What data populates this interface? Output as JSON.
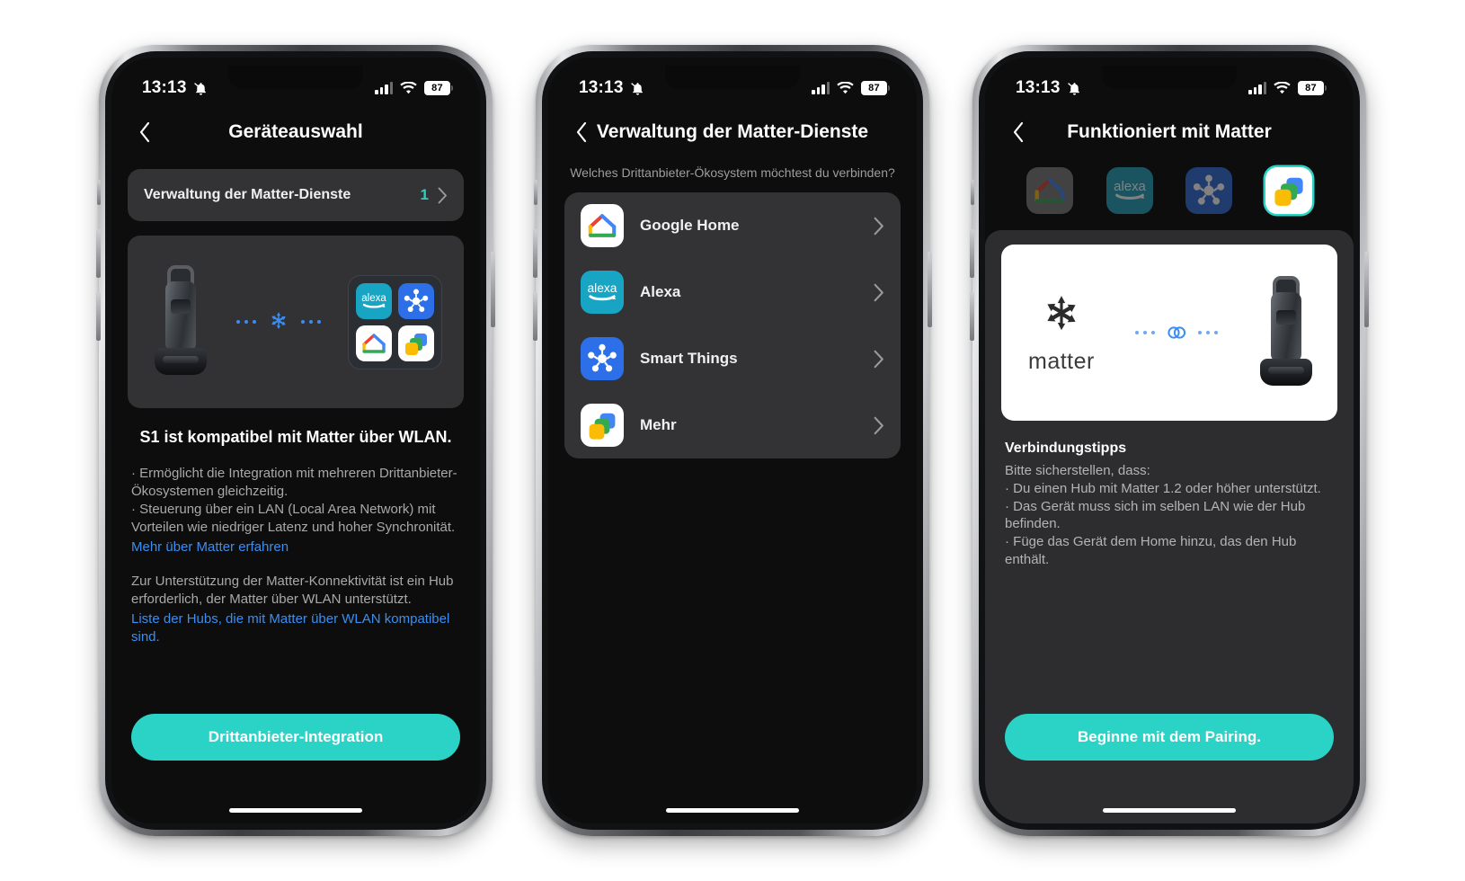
{
  "status_bar": {
    "time": "13:13",
    "mute_icon": "bell-slash-icon",
    "signal_icon": "cellular-signal-icon",
    "wifi_icon": "wifi-icon",
    "battery_level": "87"
  },
  "colors": {
    "accent_teal": "#2AD3C5",
    "count_teal": "#2ECFC0",
    "link_blue": "#3B8EF0",
    "matter_blue": "#3B8EF0",
    "card_bg": "#333335",
    "screen_bg": "#0D0D0D",
    "lower_panel_bg": "#2D2D2F",
    "alexa_brand": "#18A5C4",
    "smartthings_brand": "#2D6FE8"
  },
  "phone1": {
    "nav": {
      "back_icon": "chevron-left-icon",
      "title": "Geräteauswahl"
    },
    "service_row": {
      "label": "Verwaltung der Matter-Dienste",
      "count": "1",
      "chevron": "chevron-right-icon"
    },
    "illustration": {
      "device_icon": "robot-vacuum-icon",
      "matter_icon": "matter-logo-icon",
      "ecosystem_icons": [
        "alexa-icon",
        "smartthings-icon",
        "google-home-icon",
        "more-icon"
      ]
    },
    "compat_title": "S1 ist kompatibel mit Matter über WLAN.",
    "bullets": "· Ermöglicht die Integration mit mehreren Drittanbieter-Ökosystemen gleichzeitig.\n· Steuerung über ein LAN (Local Area Network) mit Vorteilen wie niedriger Latenz und hoher Synchronität.",
    "link_matter": "Mehr über Matter erfahren",
    "hub_paragraph": "Zur Unterstützung der Matter-Konnektivität ist ein Hub erforderlich, der Matter über WLAN unterstützt.",
    "link_hubs": "Liste der Hubs, die mit Matter über WLAN kompatibel sind.",
    "cta": "Drittanbieter-Integration"
  },
  "phone2": {
    "nav": {
      "back_icon": "chevron-left-icon",
      "title": "Verwaltung der Matter-Dienste"
    },
    "question": "Welches Drittanbieter-Ökosystem möchtest du verbinden?",
    "items": [
      {
        "label": "Google Home",
        "icon": "google-home-icon",
        "chevron": "chevron-right-icon"
      },
      {
        "label": "Alexa",
        "icon": "alexa-icon",
        "chevron": "chevron-right-icon"
      },
      {
        "label": "Smart Things",
        "icon": "smartthings-icon",
        "chevron": "chevron-right-icon"
      },
      {
        "label": "Mehr",
        "icon": "more-icon",
        "chevron": "chevron-right-icon"
      }
    ]
  },
  "phone3": {
    "nav": {
      "back_icon": "chevron-left-icon",
      "title": "Funktioniert mit Matter"
    },
    "tabs": [
      {
        "icon": "google-home-icon",
        "selected": false
      },
      {
        "icon": "alexa-icon",
        "selected": false
      },
      {
        "icon": "smartthings-icon",
        "selected": false
      },
      {
        "icon": "more-icon",
        "selected": true
      }
    ],
    "card": {
      "matter_icon": "matter-logo-icon",
      "matter_word": "matter",
      "link_icon": "link-chain-icon",
      "device_icon": "robot-vacuum-icon"
    },
    "tips_title": "Verbindungstipps",
    "tips_intro": "Bitte sicherstellen, dass:",
    "tips_lines": [
      "· Du einen Hub mit Matter 1.2 oder höher unterstützt.",
      "· Das Gerät muss sich im selben LAN wie der Hub befinden.",
      "· Füge das Gerät dem Home hinzu, das den Hub enthält."
    ],
    "cta": "Beginne mit dem Pairing."
  }
}
